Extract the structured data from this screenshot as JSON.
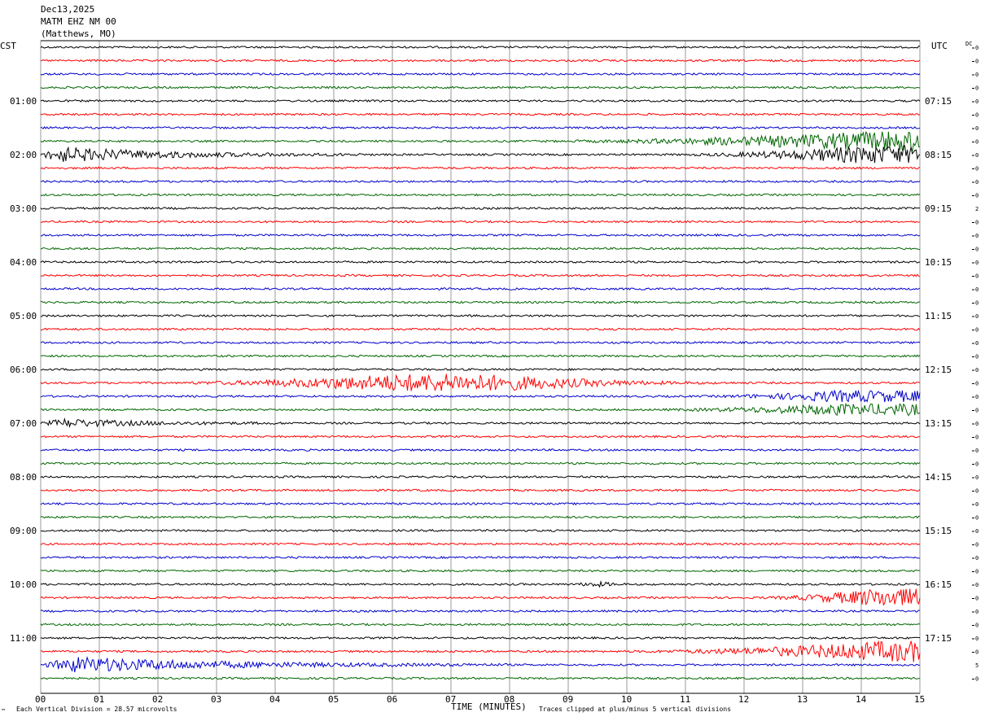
{
  "header": {
    "date": "Dec13,2025",
    "station": "MATM EHZ NM 00",
    "location": "(Matthews, MO)"
  },
  "left_timezone": "CST",
  "right_timezone": "UTC",
  "dc_label": "DC",
  "footer": {
    "corner_mark": "™",
    "scale_note": "Each Vertical Division = 28.57 microvolts",
    "xlabel": "TIME (MINUTES)",
    "clip_note": "Traces clipped at plus/minus 5 vertical divisions"
  },
  "colors": {
    "cycle": [
      "#000000",
      "#ff0000",
      "#0000cc",
      "#006600"
    ],
    "grid": "#999999"
  },
  "chart_data": {
    "type": "line",
    "xlabel": "TIME (MINUTES)",
    "xlim": [
      0,
      15
    ],
    "x_ticks": [
      "00",
      "01",
      "02",
      "03",
      "04",
      "05",
      "06",
      "07",
      "08",
      "09",
      "10",
      "11",
      "12",
      "13",
      "14",
      "15"
    ],
    "trace_count": 48,
    "minutes_per_trace": 15,
    "left_hour_labels": [
      "01:00",
      "02:00",
      "03:00",
      "04:00",
      "05:00",
      "06:00",
      "07:00",
      "08:00",
      "09:00",
      "10:00",
      "11:00"
    ],
    "right_hour_labels": [
      "07:15",
      "08:15",
      "09:15",
      "10:15",
      "11:15",
      "12:15",
      "13:15",
      "14:15",
      "15:15",
      "16:15",
      "17:15"
    ],
    "first_labeled_trace": 4,
    "dc_offsets": [
      "0",
      "0",
      "0",
      "0",
      "0",
      "0",
      "0",
      "0",
      "0",
      "0",
      "0",
      "0",
      "2",
      "0",
      "0",
      "0",
      "0",
      "0",
      "0",
      "0",
      "0",
      "0",
      "0",
      "0",
      "0",
      "0",
      "0",
      "0",
      "0",
      "0",
      "0",
      "0",
      "0",
      "0",
      "0",
      "0",
      "0",
      "0",
      "0",
      "0",
      "0",
      "0",
      "0",
      "0",
      "0",
      "0",
      "5",
      "0"
    ],
    "clip_divisions": 5,
    "noise_amplitude": 1.2,
    "events": [
      {
        "trace": 8,
        "start": 0.0,
        "peak": 0.3,
        "end": 5.5,
        "amp": 9,
        "decay": "exp"
      },
      {
        "trace": 7,
        "start": 8.0,
        "peak": 14.5,
        "end": 15.0,
        "amp": 12,
        "decay": "ramp"
      },
      {
        "trace": 8,
        "start": 10.5,
        "peak": 14.0,
        "end": 15.0,
        "amp": 10,
        "decay": "ramp"
      },
      {
        "trace": 25,
        "start": 2.5,
        "peak": 6.8,
        "end": 12.5,
        "amp": 10,
        "decay": "bell"
      },
      {
        "trace": 26,
        "start": 11.0,
        "peak": 13.5,
        "end": 15.0,
        "amp": 6,
        "decay": "ramp"
      },
      {
        "trace": 27,
        "start": 10.0,
        "peak": 13.5,
        "end": 15.0,
        "amp": 6,
        "decay": "ramp"
      },
      {
        "trace": 28,
        "start": 0.0,
        "peak": 0.4,
        "end": 4.5,
        "amp": 4.5,
        "decay": "exp"
      },
      {
        "trace": 40,
        "start": 9.0,
        "peak": 9.5,
        "end": 10.1,
        "amp": 2,
        "decay": "bell"
      },
      {
        "trace": 41,
        "start": 12.0,
        "peak": 14.2,
        "end": 15.0,
        "amp": 10,
        "decay": "ramp"
      },
      {
        "trace": 45,
        "start": 9.5,
        "peak": 14.5,
        "end": 15.0,
        "amp": 12,
        "decay": "ramp"
      },
      {
        "trace": 46,
        "start": 0.0,
        "peak": 0.6,
        "end": 8.0,
        "amp": 9,
        "decay": "exp"
      },
      {
        "trace": 30,
        "start": 0.0,
        "peak": 15.0,
        "end": 15.0,
        "amp": 0,
        "decay": "exp"
      }
    ]
  }
}
